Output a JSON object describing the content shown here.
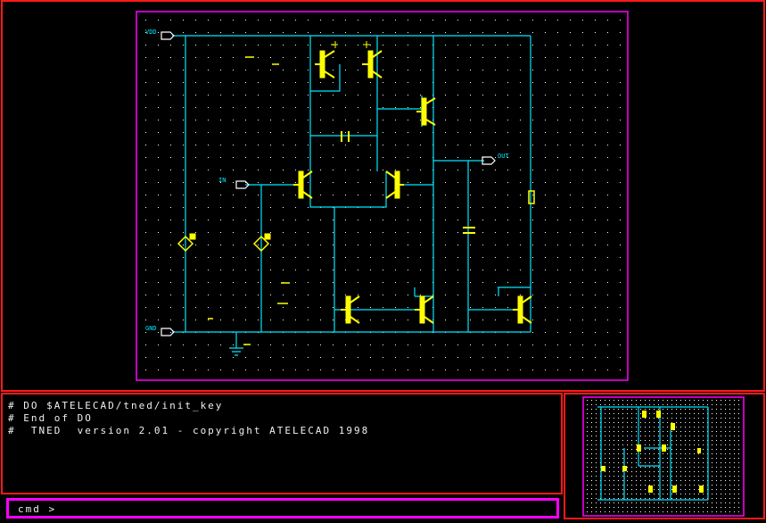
{
  "schematic": {
    "labels": {
      "vdd": "VDD",
      "gnd": "GND",
      "in": "IN",
      "out": "OUT"
    }
  },
  "console": {
    "lines": [
      "# DO $ATELECAD/tned/init_key",
      "# End of DO",
      "#  TNED  version 2.01 - copyright ATELECAD 1998"
    ]
  },
  "command": {
    "prompt": "cmd >"
  },
  "colors": {
    "wire": "#00e5ff",
    "component": "#ffff00",
    "frame": "#ff00ff",
    "panel_border": "#ff1a1a",
    "grid": "#ffffff"
  }
}
